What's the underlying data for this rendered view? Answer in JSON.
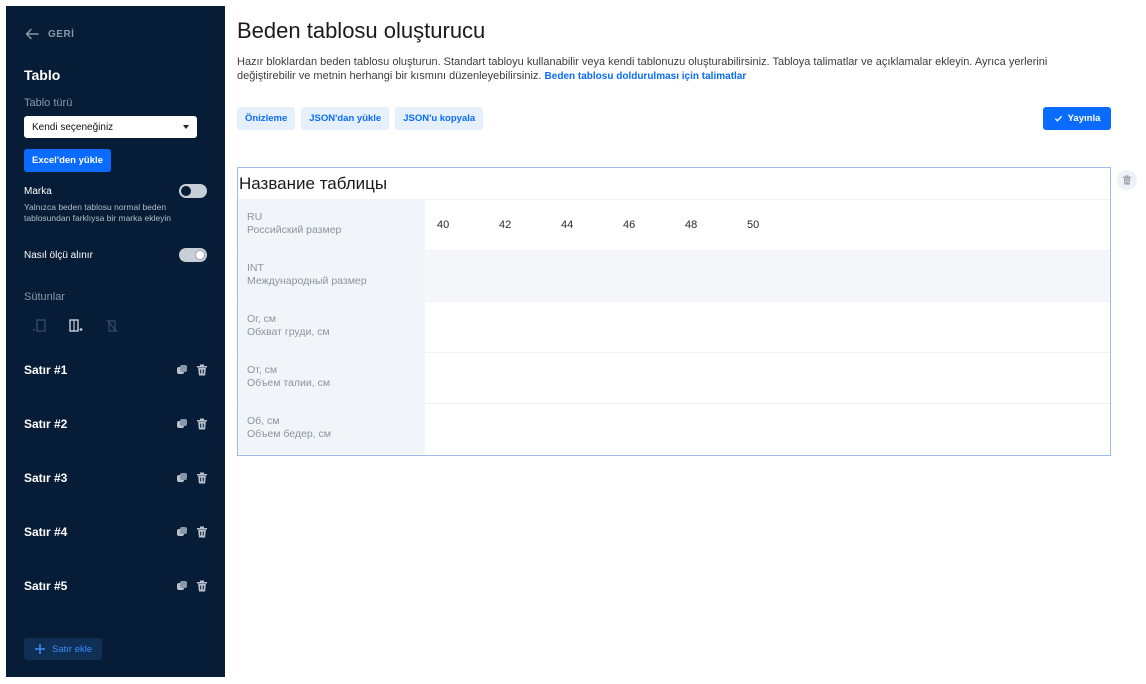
{
  "sidebar": {
    "back_label": "GERİ",
    "title": "Tablo",
    "table_type_label": "Tablo türü",
    "table_type_value": "Kendi seçeneğiniz",
    "excel_button": "Excel'den yükle",
    "brand_label": "Marka",
    "brand_toggle": "off",
    "brand_note": "Yalnızca beden tablosu normal beden tablosundan farklıysa bir marka ekleyin",
    "measure_label": "Nasıl ölçü alınır",
    "measure_toggle": "on",
    "columns_label": "Sütunlar",
    "rows": [
      {
        "label": "Satır #1"
      },
      {
        "label": "Satır #2"
      },
      {
        "label": "Satır #3"
      },
      {
        "label": "Satır #4"
      },
      {
        "label": "Satır #5"
      }
    ],
    "add_row_button": "Satır ekle"
  },
  "header": {
    "title": "Beden tablosu oluşturucu",
    "description": "Hazır bloklardan beden tablosu oluşturun. Standart tabloyu kullanabilir veya kendi tablonuzu oluşturabilirsiniz. Tabloya talimatlar ve açıklamalar ekleyin. Ayrıca yerlerini değiştirebilir ve metnin herhangi bir kısmını düzenleyebilirsiniz.",
    "instructions_link": "Beden tablosu doldurulması için talimatlar"
  },
  "toolbar": {
    "preview": "Önizleme",
    "load_json": "JSON'dan yükle",
    "copy_json": "JSON'u kopyala",
    "publish": "Yayınla"
  },
  "table": {
    "title": "Название таблицы",
    "rows": [
      {
        "code": "RU",
        "name": "Российский размер",
        "values": [
          "40",
          "42",
          "44",
          "46",
          "48",
          "50"
        ]
      },
      {
        "code": "INT",
        "name": "Международный размер",
        "values": []
      },
      {
        "code": "Ог, см",
        "name": "Обхват груди, см",
        "values": []
      },
      {
        "code": "От, см",
        "name": "Объем талии, см",
        "values": []
      },
      {
        "code": "Об, см",
        "name": "Объем бедер, см",
        "values": []
      }
    ]
  },
  "colors": {
    "sidebar_bg": "#071c36",
    "accent": "#0a6cff",
    "table_border": "#9dbde8"
  }
}
